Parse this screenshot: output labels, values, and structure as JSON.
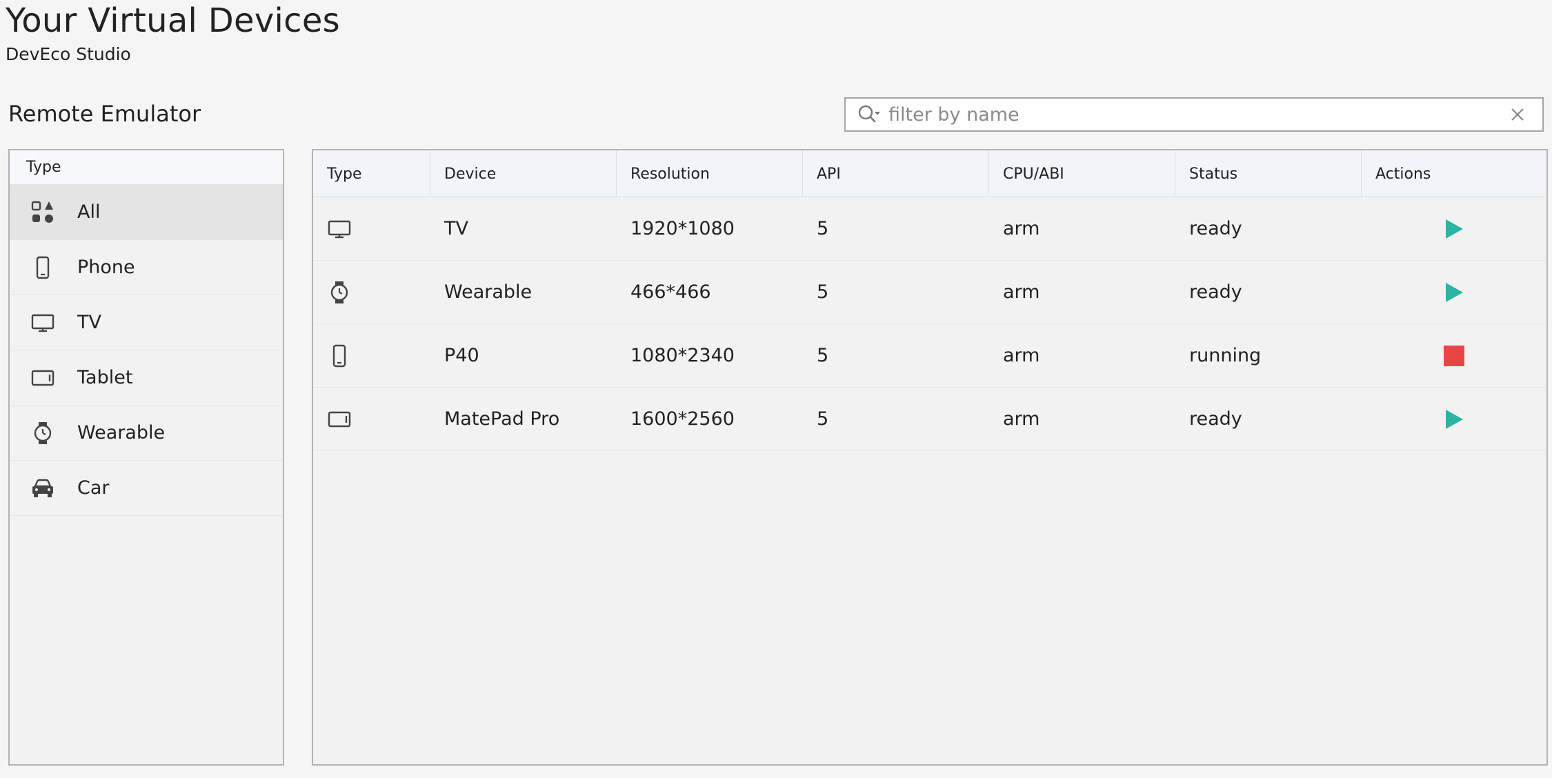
{
  "header": {
    "title": "Your Virtual Devices",
    "subtitle": "DevEco Studio"
  },
  "section": {
    "title": "Remote Emulator"
  },
  "search": {
    "placeholder": "filter by name",
    "value": "",
    "icon": "search-icon",
    "clear_icon": "close-icon"
  },
  "type_panel": {
    "header": "Type",
    "items": [
      {
        "label": "All",
        "icon": "all-categories-icon",
        "selected": true
      },
      {
        "label": "Phone",
        "icon": "phone-icon",
        "selected": false
      },
      {
        "label": "TV",
        "icon": "tv-icon",
        "selected": false
      },
      {
        "label": "Tablet",
        "icon": "tablet-icon",
        "selected": false
      },
      {
        "label": "Wearable",
        "icon": "watch-icon",
        "selected": false
      },
      {
        "label": "Car",
        "icon": "car-icon",
        "selected": false
      }
    ]
  },
  "table": {
    "columns": [
      "Type",
      "Device",
      "Resolution",
      "API",
      "CPU/ABI",
      "Status",
      "Actions"
    ],
    "rows": [
      {
        "type_icon": "tv-icon",
        "device": "TV",
        "resolution": "1920*1080",
        "api": "5",
        "cpu": "arm",
        "status": "ready",
        "action": "play"
      },
      {
        "type_icon": "watch-icon",
        "device": "Wearable",
        "resolution": "466*466",
        "api": "5",
        "cpu": "arm",
        "status": "ready",
        "action": "play"
      },
      {
        "type_icon": "phone-icon",
        "device": "P40",
        "resolution": "1080*2340",
        "api": "5",
        "cpu": "arm",
        "status": "running",
        "action": "stop"
      },
      {
        "type_icon": "tablet-icon",
        "device": "MatePad Pro",
        "resolution": "1600*2560",
        "api": "5",
        "cpu": "arm",
        "status": "ready",
        "action": "play"
      }
    ]
  },
  "colors": {
    "play": "#2bb3a3",
    "stop": "#e84545",
    "icon": "#444444"
  }
}
